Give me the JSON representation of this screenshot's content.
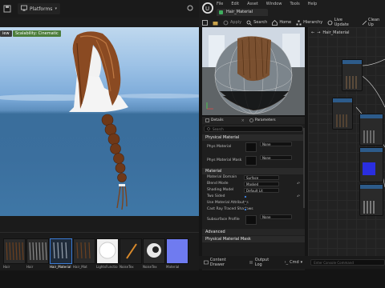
{
  "toolbar": {
    "platforms": "Platforms"
  },
  "viewport": {
    "tag_view": "iew",
    "tag_scalability": "Scalability: Cinematic"
  },
  "content_browser": {
    "items": [
      {
        "label": "Hair"
      },
      {
        "label": "Hair"
      },
      {
        "label": "Hair_Material"
      },
      {
        "label": "Hair_Mat"
      },
      {
        "label": "Hair"
      },
      {
        "label": "LightsFunctio"
      },
      {
        "label": "NoiseTex"
      },
      {
        "label": "NoiseTex"
      },
      {
        "label": "Material"
      }
    ]
  },
  "material_editor": {
    "menu": [
      "File",
      "Edit",
      "Asset",
      "Window",
      "Tools",
      "Help"
    ],
    "tab": "Hair_Material",
    "toolbar": [
      "Save",
      "Browse",
      "Apply",
      "Search",
      "Home",
      "Hierarchy",
      "Live Update",
      "Clean Up"
    ],
    "breadcrumb": "Hair_Material",
    "panels": {
      "details": "Details",
      "parameters": "Parameters"
    },
    "search_placeholder": "Search",
    "sections": {
      "physical_material": "Physical Material",
      "material": "Material",
      "advanced": "Advanced",
      "physical_material_mask": "Physical Material Mask"
    },
    "props": {
      "phys_material": "Phys Material",
      "phys_material_mask": "Phys Material Mask",
      "material_domain": "Material Domain",
      "blend_mode": "Blend Mode",
      "shading_model": "Shading Model",
      "two_sided": "Two Sided",
      "use_material_attributes": "Use Material Attributes",
      "cast_ray_traced_shadows": "Cast Ray Traced Shadows",
      "subsurface_profile": "Subsurface Profile"
    },
    "values": {
      "none": "None",
      "surface": "Surface",
      "masked": "Masked",
      "default_lit": "Default Lit"
    },
    "bottom_tabs": [
      "Content Drawer",
      "Output Log",
      "Cmd"
    ],
    "cmd_placeholder": "Enter Console Command"
  }
}
